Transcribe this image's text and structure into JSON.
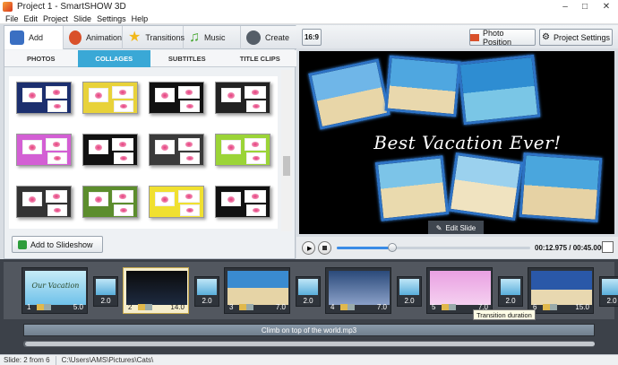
{
  "window": {
    "title": "Project 1 - SmartSHOW 3D",
    "min": "–",
    "max": "□",
    "close": "✕"
  },
  "menu": [
    "File",
    "Edit",
    "Project",
    "Slide",
    "Settings",
    "Help"
  ],
  "main_tabs": [
    {
      "label": "Add",
      "color": "#3a6fc2"
    },
    {
      "label": "Animation",
      "color": "#d9502a"
    },
    {
      "label": "Transitions",
      "color": "#f1b81a"
    },
    {
      "label": "Music",
      "color": "#48a832"
    },
    {
      "label": "Create",
      "color": "#555e68"
    }
  ],
  "sub_tabs": [
    "PHOTOS",
    "COLLAGES",
    "SUBTITLES",
    "TITLE CLIPS"
  ],
  "collages": [
    {
      "bg": "#1c2f6e"
    },
    {
      "bg": "#e8d23a"
    },
    {
      "bg": "#111111"
    },
    {
      "bg": "#222222"
    },
    {
      "bg": "#d35fd4"
    },
    {
      "bg": "#111111"
    },
    {
      "bg": "#3a3a3a"
    },
    {
      "bg": "#9bd437"
    },
    {
      "bg": "#333333"
    },
    {
      "bg": "#5c8d2d"
    },
    {
      "bg": "#f0e030"
    },
    {
      "bg": "#111111"
    }
  ],
  "add_button": "Add to Slideshow",
  "aspect": "16:9",
  "toolbar": {
    "photo_position": "Photo Position",
    "project_settings": "Project Settings"
  },
  "preview": {
    "caption": "Best Vacation Ever!",
    "edit_slide": "Edit Slide"
  },
  "player": {
    "time": "00:12.975 / 00:45.000",
    "progress": 0.288
  },
  "slides": [
    {
      "num": "1",
      "duration": "5.0",
      "selected": false,
      "caption": "Our Vacation"
    },
    {
      "num": "2",
      "duration": "14.0",
      "selected": true,
      "caption": ""
    },
    {
      "num": "3",
      "duration": "7.0",
      "selected": false,
      "caption": ""
    },
    {
      "num": "4",
      "duration": "7.0",
      "selected": false,
      "caption": ""
    },
    {
      "num": "5",
      "duration": "7.0",
      "selected": false,
      "caption": ""
    },
    {
      "num": "6",
      "duration": "15.0",
      "selected": false,
      "caption": ""
    }
  ],
  "transitions": [
    "2.0",
    "2.0",
    "2.0",
    "2.0",
    "2.0",
    "2.0"
  ],
  "tooltip": "Transition duration",
  "audio": "Climb on top of the world.mp3",
  "status": {
    "slide": "Slide: 2 from 6",
    "path": "C:\\Users\\AMS\\Pictures\\Cats\\"
  }
}
